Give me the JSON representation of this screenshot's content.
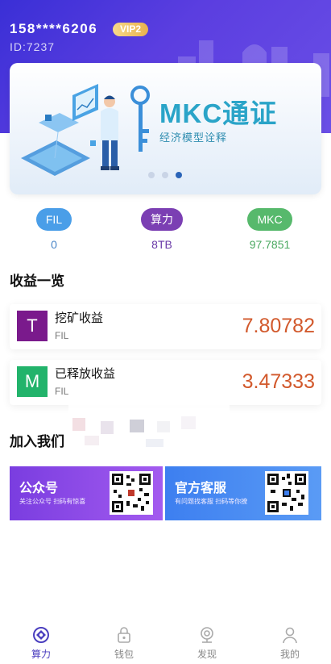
{
  "user": {
    "phone": "158****6206",
    "vip": "VIP2",
    "id": "ID:7237"
  },
  "banner": {
    "title": "MKC通证",
    "subtitle": "经济模型诠释",
    "slide_index": 3,
    "slide_count": 3
  },
  "stats": [
    {
      "label": "FIL",
      "value": "0",
      "color": "#4a9ee8",
      "value_color": "#4a86c8"
    },
    {
      "label": "算力",
      "value": "8TB",
      "color": "#7b3fb3",
      "value_color": "#6a3aa8"
    },
    {
      "label": "MKC",
      "value": "97.7851",
      "color": "#57b96c",
      "value_color": "#4aa860"
    }
  ],
  "earnings": {
    "title": "收益一览",
    "items": [
      {
        "letter": "T",
        "name": "挖矿收益",
        "unit": "FIL",
        "amount": "7.80782",
        "color": "#7a1a8c"
      },
      {
        "letter": "M",
        "name": "已释放收益",
        "unit": "FIL",
        "amount": "3.47333",
        "color": "#22b36b"
      }
    ]
  },
  "join": {
    "title": "加入我们",
    "cards": [
      {
        "title": "公众号",
        "subtitle": "关注公众号 扫码有惊喜"
      },
      {
        "title": "官方客服",
        "subtitle": "有问题找客服 扫码等你撩"
      }
    ]
  },
  "tabbar": [
    {
      "label": "算力",
      "icon": "mining-icon",
      "active": true
    },
    {
      "label": "钱包",
      "icon": "wallet-icon",
      "active": false
    },
    {
      "label": "发现",
      "icon": "discover-icon",
      "active": false
    },
    {
      "label": "我的",
      "icon": "profile-icon",
      "active": false
    }
  ]
}
